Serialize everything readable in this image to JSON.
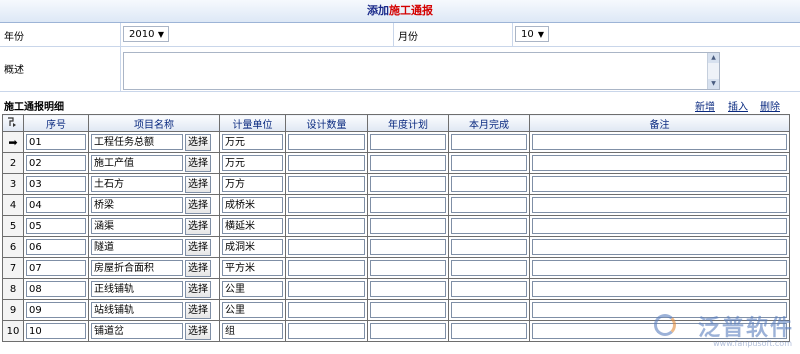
{
  "title": {
    "part1": "添加",
    "part2": "施工通报"
  },
  "form": {
    "year_label": "年份",
    "year_value": "2010",
    "month_label": "月份",
    "month_value": "10",
    "desc_label": "概述"
  },
  "section": {
    "title": "施工通报明细",
    "add": "新增",
    "insert": "插入",
    "delete": "删除"
  },
  "columns": [
    "序号",
    "项目名称",
    "计量单位",
    "设计数量",
    "年度计划",
    "本月完成",
    "备注"
  ],
  "rows": [
    {
      "rn": "1",
      "seq": "01",
      "name": "工程任务总额",
      "unit": "万元",
      "current": true
    },
    {
      "rn": "2",
      "seq": "02",
      "name": "施工产值",
      "unit": "万元"
    },
    {
      "rn": "3",
      "seq": "03",
      "name": "土石方",
      "unit": "万方"
    },
    {
      "rn": "4",
      "seq": "04",
      "name": "桥梁",
      "unit": "成桥米"
    },
    {
      "rn": "5",
      "seq": "05",
      "name": "涵渠",
      "unit": "横延米"
    },
    {
      "rn": "6",
      "seq": "06",
      "name": "隧道",
      "unit": "成洞米"
    },
    {
      "rn": "7",
      "seq": "07",
      "name": "房屋折合面积",
      "unit": "平方米"
    },
    {
      "rn": "8",
      "seq": "08",
      "name": "正线铺轨",
      "unit": "公里"
    },
    {
      "rn": "9",
      "seq": "09",
      "name": "站线铺轨",
      "unit": "公里"
    },
    {
      "rn": "10",
      "seq": "10",
      "name": "铺道岔",
      "unit": "组"
    }
  ],
  "select_btn": "选择",
  "watermark": {
    "text": "泛普软件",
    "url": "www.fanpusoft.com"
  }
}
